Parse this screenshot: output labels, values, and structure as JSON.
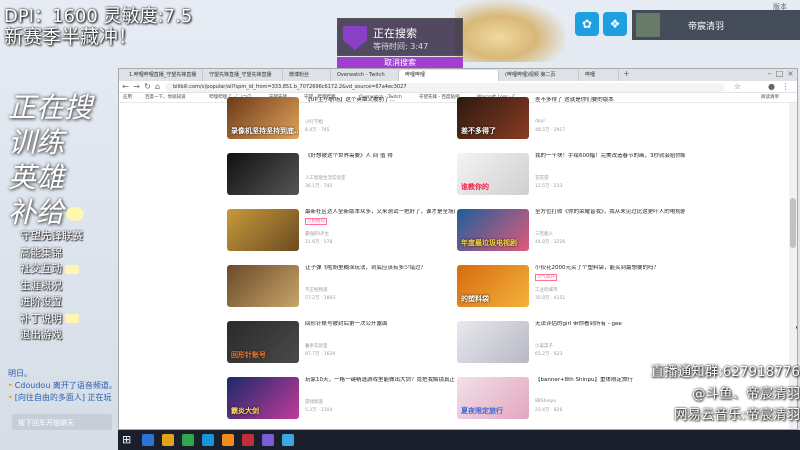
{
  "overlay": {
    "dpi": "DPI：1600 灵敏度:7.5",
    "season": "新赛季半藏冲！",
    "big_lines": [
      "正在搜",
      "训练",
      "英雄",
      "补给"
    ],
    "menu": [
      "守望先锋联赛",
      "高能集锦",
      "社交互动",
      "生涯概况",
      "进阶设置",
      "补丁说明",
      "退出游戏"
    ],
    "chat": {
      "header": "明日。",
      "lines": [
        "Cdoudou 离开了语音频道。",
        "[向往自由的多面人] 正在玩"
      ],
      "input_placeholder": "按下回车开始聊天"
    },
    "notice": [
      "直播通知群:627918776",
      "@斗鱼、帝宸清羽",
      "网易云音乐:帝宸清羽"
    ],
    "version": "版本"
  },
  "search_panel": {
    "title": "正在搜索",
    "wait": "等待时间: 3:47",
    "cancel": "取消搜索"
  },
  "profile": {
    "name": "帝宸清羽"
  },
  "browser": {
    "tabs": [
      "1.哔哩哔哩直播_守望先锋直播",
      "守望先锋直播_守望先锋直播",
      "微博粉丝",
      "Overwatch - Twitch",
      "哔哩哔哩",
      "(哔哩哔哩)视频 第二页",
      "哔哩"
    ],
    "active_tab": 4,
    "url": "bilibili.com/v/popular/all?spm_id_from=333.851.b_7072696c6172.2&vd_source=67a4ec3027",
    "bookmarks": [
      "应用",
      "百度一下，你就知道",
      "哔哩哔哩 (゜-゜)つロ",
      "守望先锋",
      "守望 - 哔哩哔哩",
      "Overwatch - Twitch",
      "守望先锋 - 百度贴吧",
      "Warcraft Logs - C",
      "阅读清单"
    ],
    "cards": [
      {
        "title": "【UP主小剧场】这个英雄又被削了…",
        "cap": "录像机坚持坚持到底…",
        "badge": "",
        "up": "小叮学姐",
        "stats": "8.4万 · 745"
      },
      {
        "title": "差不多得了 这就是你们要的版本",
        "cap": "差不多得了",
        "badge": "",
        "up": "dpyr",
        "stats": "48.5万 · 2917"
      },
      {
        "title": "《好想被这个世界需要》人 间 值 得",
        "cap": "",
        "badge": "",
        "up": "人工智能生活实验室",
        "stats": "36.1万 · 745"
      },
      {
        "title": "我的一千块！手绘600幅！完美改造春节的画，3秒就会给你解惑",
        "cap": "谁教你的",
        "badge": "",
        "up": "花花游",
        "stats": "12.5万 · 233"
      },
      {
        "title": "最新社区达人全新版本众多，又来测试一把好了，谁才是全场最强？",
        "cap": "",
        "badge": "万粉推荐",
        "up": "最强的UP主",
        "stats": "21.6万 · 578"
      },
      {
        "title": "全方位打败《你的荣耀皆我》，我从未见过比这更吓人的电视剧",
        "cap": "年度最垃圾电视剧",
        "badge": "",
        "up": "三百鹿人",
        "stats": "44.8万 · 3226"
      },
      {
        "title": "让子弹飞啦胡里糊涂玩法，到底应该有多少错过？",
        "cap": "",
        "badge": "",
        "up": "不正经频道",
        "stats": "57.2万 · 1803"
      },
      {
        "title": "小伙花2000元买了个塑料袋，能买到最想要的吗？",
        "cap": "的塑料袋",
        "badge": "人气飙升",
        "up": "工业的城市",
        "stats": "35.8万 · 4151"
      },
      {
        "title": "回形针账号被封后第一次公开露面",
        "cap": "回形针账号",
        "badge": "",
        "up": "薯条实验室",
        "stats": "87.7万 · 1629"
      },
      {
        "title": "无法评估的girl 带你看到所有 - gee",
        "cap": "",
        "badge": "",
        "up": "小美菜子",
        "stats": "65.2万 · 623"
      },
      {
        "title": "玩家10天，一格一键精选游戏里能做出大剑？竟把我解锁真正的技术了",
        "cap": "霸炎大剑",
        "badge": "",
        "up": "游戏频道",
        "stats": "5.3万 · 1104"
      },
      {
        "title": "【banner+8th Shinpu】重体限定旅行",
        "cap": "夏夜限定旅行",
        "badge": "",
        "up": "88Shinpu",
        "stats": "23.4万 · 826"
      }
    ]
  }
}
